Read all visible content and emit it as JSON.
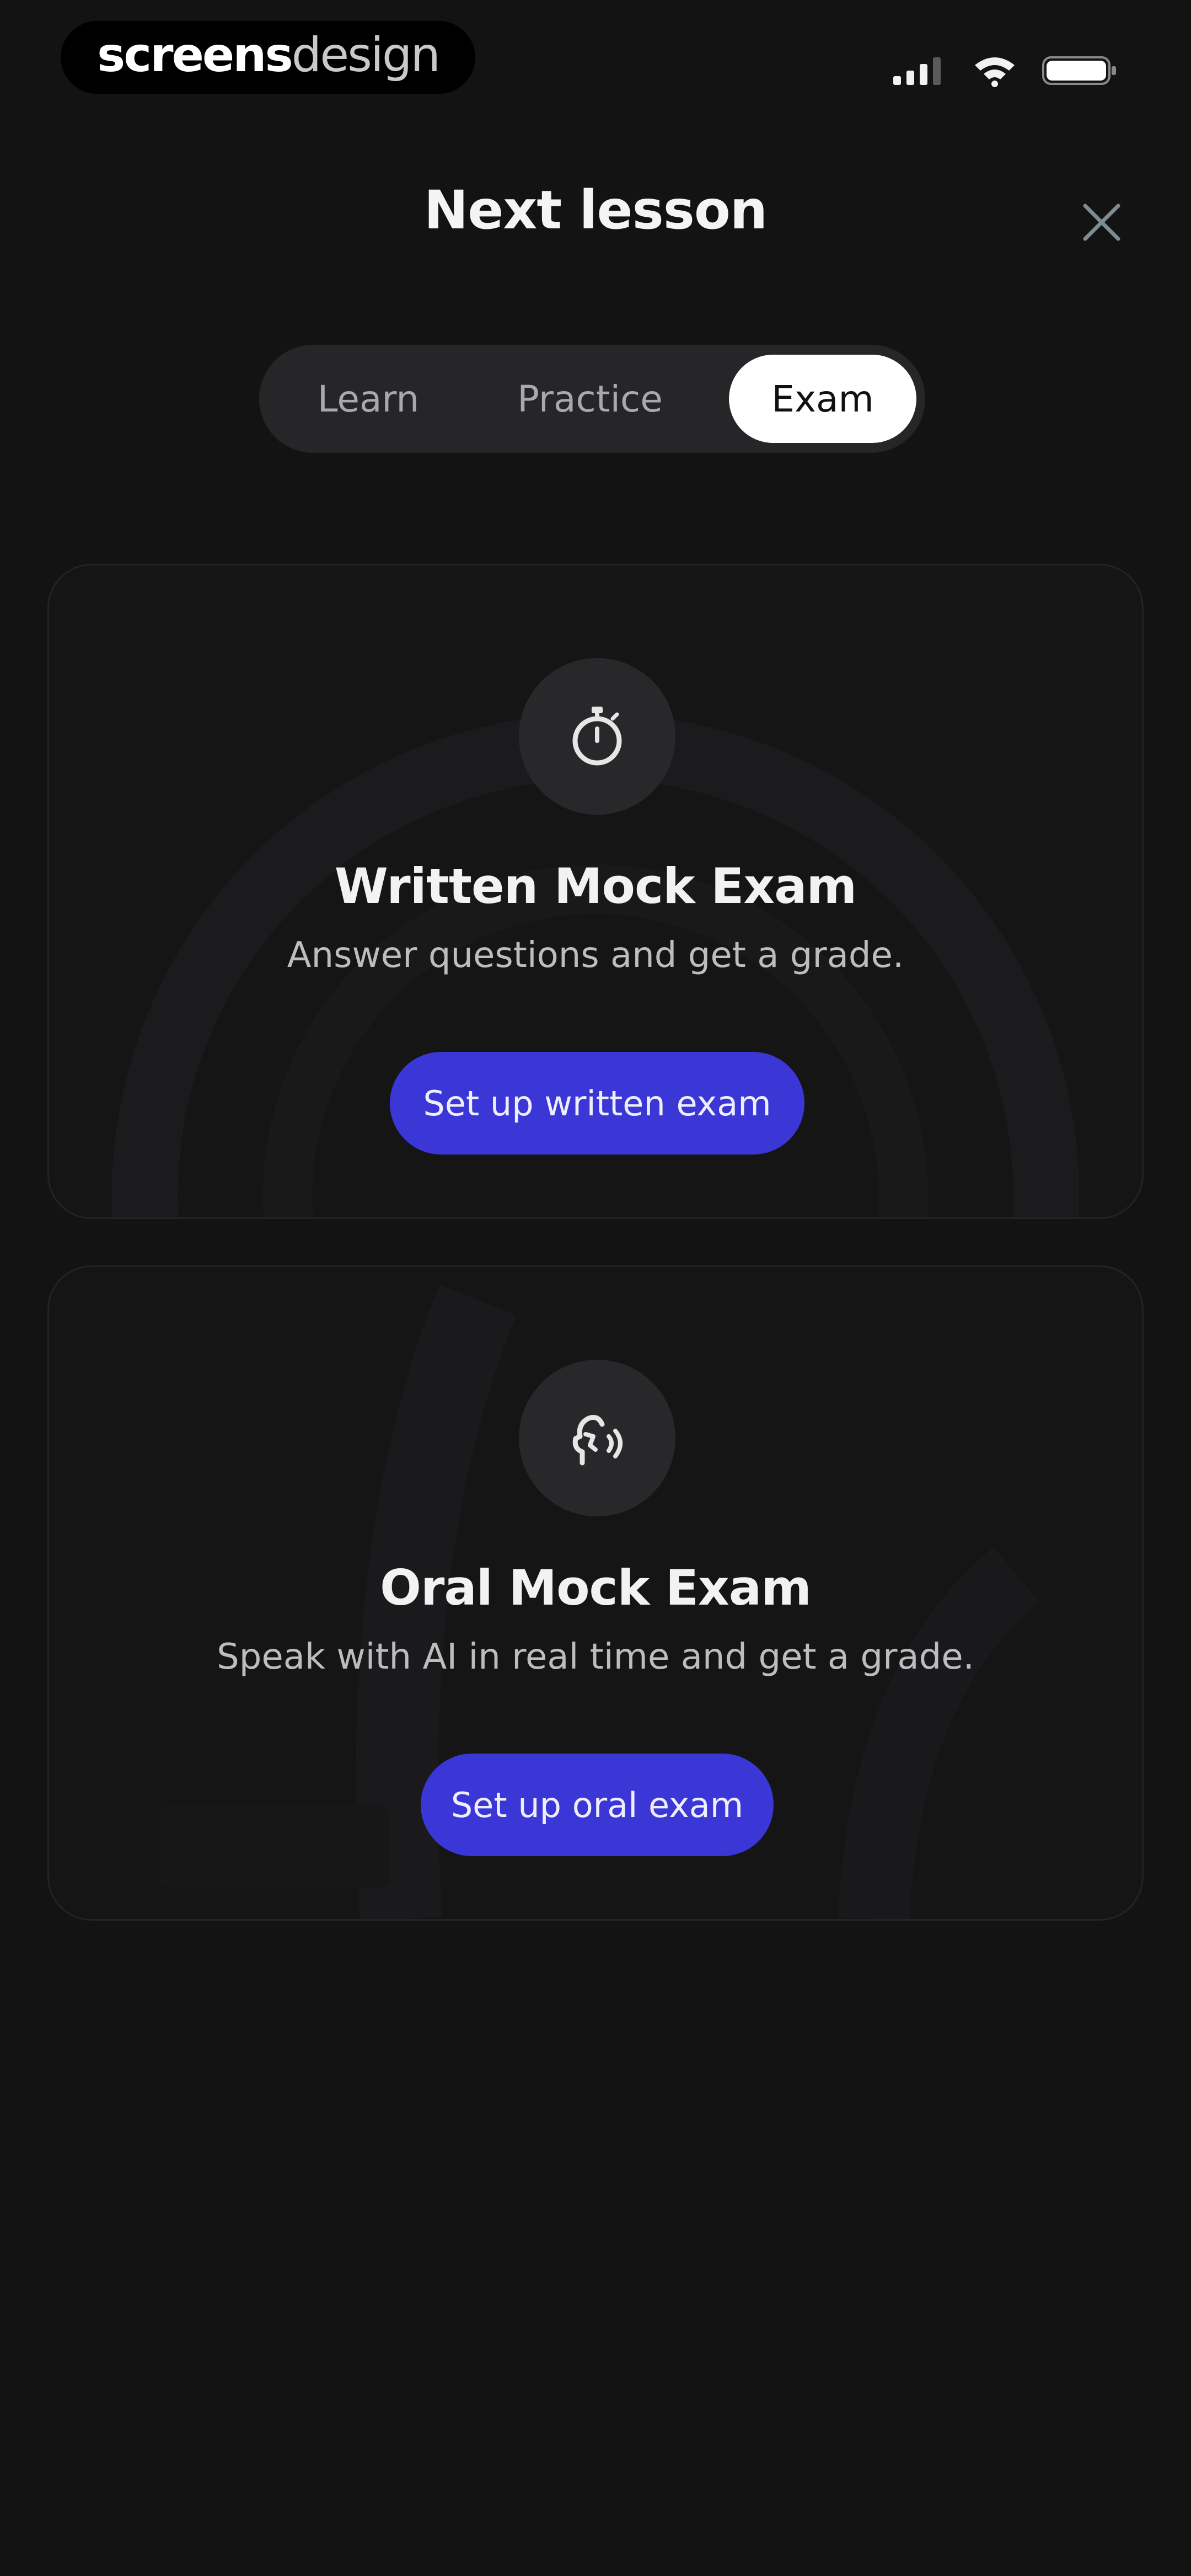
{
  "status_bar": {
    "brand_part1": "screens",
    "brand_part2": "design"
  },
  "header": {
    "title": "Next lesson",
    "close_icon": "close-icon"
  },
  "tabs": [
    {
      "label": "Learn",
      "selected": false
    },
    {
      "label": "Practice",
      "selected": false
    },
    {
      "label": "Exam",
      "selected": true
    }
  ],
  "cards": [
    {
      "icon": "stopwatch-icon",
      "title": "Written Mock Exam",
      "description": "Answer questions and get a grade.",
      "button_label": "Set up written exam"
    },
    {
      "icon": "speaking-head-icon",
      "title": "Oral Mock Exam",
      "description": "Speak with AI in real time and get a grade.",
      "button_label": "Set up oral exam"
    }
  ],
  "colors": {
    "background": "#131314",
    "accent": "#3a37d6",
    "selected_tab": "#ffffff"
  }
}
